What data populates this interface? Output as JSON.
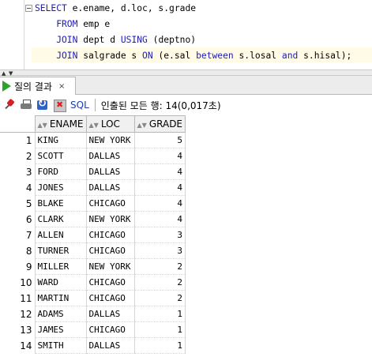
{
  "editor": {
    "lines": [
      [
        {
          "t": "SELECT",
          "k": 1
        },
        {
          "t": " e.ename, d.loc, s.grade",
          "k": 0
        }
      ],
      [
        {
          "t": "    FROM",
          "k": 1
        },
        {
          "t": " emp e",
          "k": 0
        }
      ],
      [
        {
          "t": "    JOIN",
          "k": 1
        },
        {
          "t": " dept d ",
          "k": 0
        },
        {
          "t": "USING",
          "k": 1
        },
        {
          "t": " (deptno)",
          "k": 0
        }
      ],
      [
        {
          "t": "    JOIN",
          "k": 1
        },
        {
          "t": " salgrade s ",
          "k": 0
        },
        {
          "t": "ON",
          "k": 1
        },
        {
          "t": " (e.sal ",
          "k": 0
        },
        {
          "t": "between",
          "k": 1
        },
        {
          "t": " s.losal ",
          "k": 0
        },
        {
          "t": "and",
          "k": 1
        },
        {
          "t": " s.hisal);",
          "k": 0
        }
      ]
    ]
  },
  "tab": {
    "label": "질의 결과",
    "close": "×"
  },
  "toolbar": {
    "sql_label": "SQL",
    "status": "인출된 모든 행: 14(0,017초)"
  },
  "grid": {
    "columns": [
      "ENAME",
      "LOC",
      "GRADE"
    ],
    "rows": [
      [
        "1",
        "KING",
        "NEW YORK",
        "5"
      ],
      [
        "2",
        "SCOTT",
        "DALLAS",
        "4"
      ],
      [
        "3",
        "FORD",
        "DALLAS",
        "4"
      ],
      [
        "4",
        "JONES",
        "DALLAS",
        "4"
      ],
      [
        "5",
        "BLAKE",
        "CHICAGO",
        "4"
      ],
      [
        "6",
        "CLARK",
        "NEW YORK",
        "4"
      ],
      [
        "7",
        "ALLEN",
        "CHICAGO",
        "3"
      ],
      [
        "8",
        "TURNER",
        "CHICAGO",
        "3"
      ],
      [
        "9",
        "MILLER",
        "NEW YORK",
        "2"
      ],
      [
        "10",
        "WARD",
        "CHICAGO",
        "2"
      ],
      [
        "11",
        "MARTIN",
        "CHICAGO",
        "2"
      ],
      [
        "12",
        "ADAMS",
        "DALLAS",
        "1"
      ],
      [
        "13",
        "JAMES",
        "CHICAGO",
        "1"
      ],
      [
        "14",
        "SMITH",
        "DALLAS",
        "1"
      ]
    ]
  },
  "colors": {
    "keyword": "#1c1cb8",
    "run_icon": "#2aa52a",
    "sql_link": "#1c3fa8"
  }
}
